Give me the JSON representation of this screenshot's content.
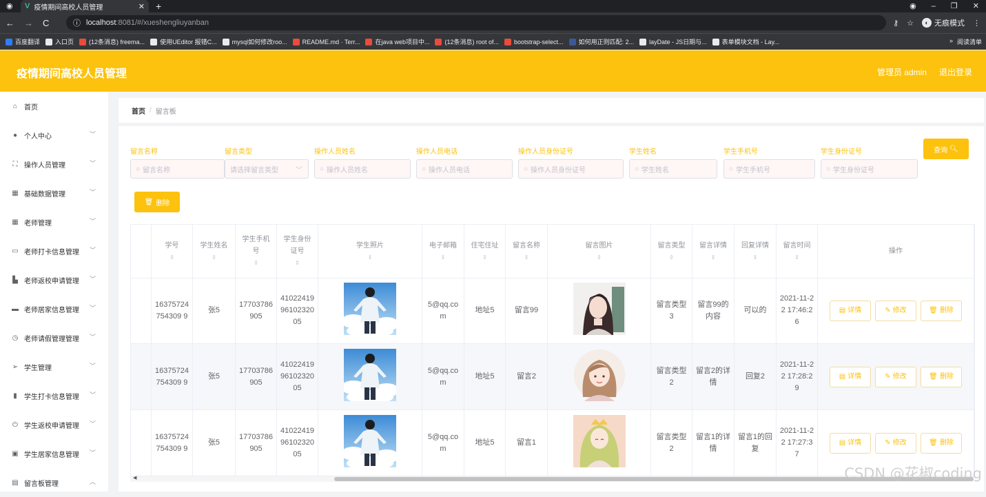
{
  "browser": {
    "tab_title": "疫情期间高校人员管理",
    "url_host": "localhost",
    "url_path": ":8081/#/xueshengliuyanban",
    "incognito_label": "无痕模式",
    "bookmarks": [
      "百度翻译",
      "入口页",
      "(12条消息) freema...",
      "使用UEditor 报错C...",
      "mysql如何修改roo...",
      "README.md · Terr...",
      "在java web项目中...",
      "(12条消息) root of...",
      "bootstrap-select...",
      "如何用正则匹配: 2...",
      "layDate - JS日期与...",
      "表单模块文档 - Lay..."
    ],
    "reading_list": "阅读清单"
  },
  "app": {
    "title": "疫情期间高校人员管理",
    "user_label": "管理员 admin",
    "logout_label": "退出登录"
  },
  "sidebar": {
    "items": [
      {
        "label": "首页",
        "icon": "home-icon"
      },
      {
        "label": "个人中心",
        "icon": "user-icon"
      },
      {
        "label": "操作人员管理",
        "icon": "frame-icon"
      },
      {
        "label": "基础数据管理",
        "icon": "grid-icon"
      },
      {
        "label": "老师管理",
        "icon": "grid9-icon"
      },
      {
        "label": "老师打卡信息管理",
        "icon": "message-icon"
      },
      {
        "label": "老师返校申请管理",
        "icon": "chart-icon"
      },
      {
        "label": "老师居家信息管理",
        "icon": "house-icon"
      },
      {
        "label": "老师请假管理管理",
        "icon": "clock-icon"
      },
      {
        "label": "学生管理",
        "icon": "send-icon"
      },
      {
        "label": "学生打卡信息管理",
        "icon": "bars-icon"
      },
      {
        "label": "学生返校申请管理",
        "icon": "power-icon"
      },
      {
        "label": "学生居家信息管理",
        "icon": "delete-icon"
      },
      {
        "label": "留言板管理",
        "icon": "board-icon"
      }
    ]
  },
  "breadcrumb": {
    "home": "首页",
    "separator": "/",
    "current": "留言板"
  },
  "filters": [
    {
      "label": "留言名称",
      "placeholder": "留言名称"
    },
    {
      "label": "留言类型",
      "placeholder": "请选择留言类型"
    },
    {
      "label": "操作人员姓名",
      "placeholder": "操作人员姓名"
    },
    {
      "label": "操作人员电话",
      "placeholder": "操作人员电话"
    },
    {
      "label": "操作人员身份证号",
      "placeholder": "操作人员身份证号"
    },
    {
      "label": "学生姓名",
      "placeholder": "学生姓名"
    },
    {
      "label": "学生手机号",
      "placeholder": "学生手机号"
    },
    {
      "label": "学生身份证号",
      "placeholder": "学生身份证号"
    }
  ],
  "search_button": "查询",
  "delete_button": "删除",
  "columns": [
    "学号",
    "学生姓名",
    "学生手机号",
    "学生身份证号",
    "学生照片",
    "电子邮箱",
    "住宅住址",
    "留言名称",
    "留言图片",
    "留言类型",
    "留言详情",
    "回复详情",
    "留言时间",
    "操作"
  ],
  "rows": [
    {
      "student_no": "16375724754309 9",
      "name": "张5",
      "phone": "17703786905",
      "id_card": "410224199610232005",
      "email": "5@qq.com",
      "address": "地址5",
      "msg_name": "留言99",
      "msg_type": "留言类型3",
      "msg_detail": "留言99的内容",
      "reply": "可以的",
      "time": "2021-11-22 17:46:26"
    },
    {
      "student_no": "16375724754309 9",
      "name": "张5",
      "phone": "17703786905",
      "id_card": "410224199610232005",
      "email": "5@qq.com",
      "address": "地址5",
      "msg_name": "留言2",
      "msg_type": "留言类型2",
      "msg_detail": "留言2的详情",
      "reply": "回复2",
      "time": "2021-11-22 17:28:29"
    },
    {
      "student_no": "16375724754309 9",
      "name": "张5",
      "phone": "17703786905",
      "id_card": "410224199610232005",
      "email": "5@qq.com",
      "address": "地址5",
      "msg_name": "留言1",
      "msg_type": "留言类型2",
      "msg_detail": "留言1的详情",
      "reply": "留言1的回复",
      "time": "2021-11-22 17:27:37"
    }
  ],
  "row_actions": {
    "detail": "详情",
    "edit": "修改",
    "delete": "删除"
  },
  "watermark": "CSDN @花椒coding",
  "colors": {
    "accent": "#fcc20d",
    "header_text": "#ffffff"
  }
}
